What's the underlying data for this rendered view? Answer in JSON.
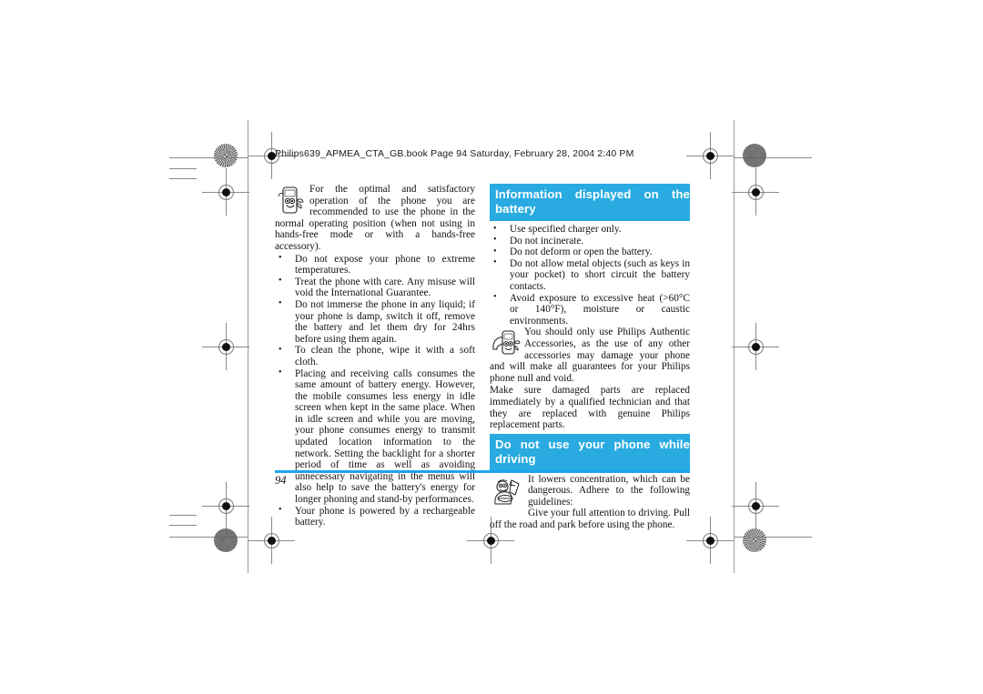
{
  "document": {
    "book_header": "Philips639_APMEA_CTA_GB.book  Page 94  Saturday, February 28, 2004  2:40 PM",
    "page_number": "94",
    "accent_color": "#29ABE2",
    "rule_color": "#1CA3EE"
  },
  "left_column": {
    "intro": "For the optimal and satisfactory operation of the phone you are recommended to use the phone in the normal operating position (when not using in hands-free mode or with a hands-free accessory).",
    "intro_icon": "phone-character-icon",
    "bullets": [
      "Do not expose your phone to extreme temperatures.",
      "Treat the phone with care. Any misuse will void the International Guarantee.",
      "Do not immerse the phone in any liquid; if your phone is damp, switch it off, remove the battery and let them dry for 24hrs before using them again.",
      "To clean the phone, wipe it with a soft cloth.",
      "Placing and receiving calls consumes the same amount of battery energy. However, the mobile consumes less energy in idle screen when kept in the same place. When in idle screen and while you are moving, your phone consumes energy to transmit updated location information to the network. Setting the backlight for a shorter period of time as well as avoiding unnecessary navigating in the menus will also help to save the battery's energy for longer phoning and stand-by performances.",
      "Your phone is powered by a rechargeable battery."
    ]
  },
  "right_column": {
    "section_battery": {
      "heading": "Information displayed on the battery",
      "bullets": [
        "Use specified charger only.",
        "Do not incinerate.",
        "Do not deform or open the battery.",
        "Do not allow metal objects (such as keys in your pocket) to short circuit the battery contacts.",
        "Avoid exposure to excessive heat (>60°C or 140°F), moisture or caustic environments."
      ],
      "accessories_icon": "phone-accessory-character-icon",
      "accessories_note": "You should only use Philips Authentic Accessories, as the use of any other accessories may damage your phone and will make all guarantees for your Philips phone null and void.",
      "repair_note": "Make sure damaged parts are replaced immediately by a qualified technician and that they are replaced with genuine Philips replacement parts."
    },
    "section_driving": {
      "heading": "Do not use your phone while driving",
      "driving_icon": "driving-character-icon",
      "paragraph_1": "It lowers concentration, which can be dangerous. Adhere to the following guidelines:",
      "paragraph_2": "Give your full attention to driving. Pull off the road and park before using the phone."
    }
  }
}
